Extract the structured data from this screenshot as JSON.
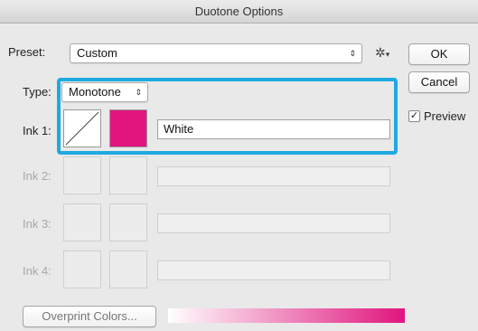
{
  "window": {
    "title": "Duotone Options"
  },
  "preset": {
    "label": "Preset:",
    "value": "Custom",
    "gear_icon": "gear-icon"
  },
  "buttons": {
    "ok": "OK",
    "cancel": "Cancel"
  },
  "preview": {
    "label": "Preview",
    "checked": true,
    "check_glyph": "✓"
  },
  "type": {
    "label": "Type:",
    "value": "Monotone"
  },
  "inks": [
    {
      "label": "Ink 1:",
      "name": "White",
      "color": "#e0157d",
      "enabled": true
    },
    {
      "label": "Ink 2:",
      "name": "",
      "enabled": false
    },
    {
      "label": "Ink 3:",
      "name": "",
      "enabled": false
    },
    {
      "label": "Ink 4:",
      "name": "",
      "enabled": false
    }
  ],
  "overprint": {
    "label": "Overprint Colors..."
  },
  "colors": {
    "accent_highlight": "#1fa9e1",
    "ink_color": "#e0157d",
    "gradient_start": "#ffffff",
    "gradient_end": "#e0157d"
  }
}
